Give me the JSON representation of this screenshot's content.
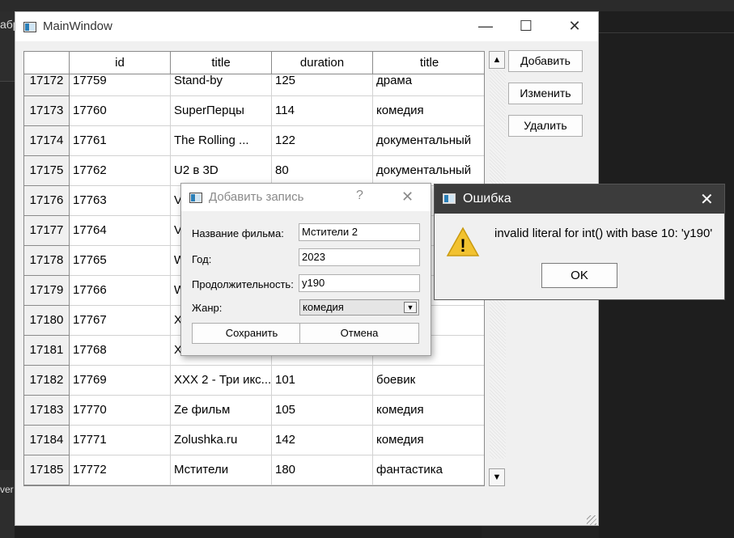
{
  "background": {
    "left_text_top": "абр",
    "left_text_bottom": "ver"
  },
  "main_window": {
    "title": "MainWindow",
    "controls": {
      "minimize": "—",
      "maximize": "☐",
      "close": "✕"
    },
    "table": {
      "headers": [
        "id",
        "title",
        "duration",
        "title"
      ],
      "rows": [
        {
          "row_header": "17172",
          "cells": [
            "17759",
            "Stand-by",
            "125",
            "драма"
          ]
        },
        {
          "row_header": "17173",
          "cells": [
            "17760",
            "SuperПерцы",
            "114",
            "комедия"
          ]
        },
        {
          "row_header": "17174",
          "cells": [
            "17761",
            "The Rolling ...",
            "122",
            "документальный"
          ]
        },
        {
          "row_header": "17175",
          "cells": [
            "17762",
            "U2 в 3D",
            "80",
            "документальный"
          ]
        },
        {
          "row_header": "17176",
          "cells": [
            "17763",
            "V",
            "",
            ""
          ]
        },
        {
          "row_header": "17177",
          "cells": [
            "17764",
            "V",
            "",
            ""
          ]
        },
        {
          "row_header": "17178",
          "cells": [
            "17765",
            "W",
            "",
            ""
          ]
        },
        {
          "row_header": "17179",
          "cells": [
            "17766",
            "W",
            "",
            ""
          ]
        },
        {
          "row_header": "17180",
          "cells": [
            "17767",
            "X",
            "",
            ""
          ]
        },
        {
          "row_header": "17181",
          "cells": [
            "17768",
            "X",
            "",
            ""
          ]
        },
        {
          "row_header": "17182",
          "cells": [
            "17769",
            "XXX 2 - Три икс...",
            "101",
            "боевик"
          ]
        },
        {
          "row_header": "17183",
          "cells": [
            "17770",
            "Ze фильм",
            "105",
            "комедия"
          ]
        },
        {
          "row_header": "17184",
          "cells": [
            "17771",
            "Zolushka.ru",
            "142",
            "комедия"
          ]
        },
        {
          "row_header": "17185",
          "cells": [
            "17772",
            "Мстители",
            "180",
            "фантастика"
          ]
        }
      ]
    },
    "buttons": {
      "add": "Добавить",
      "edit": "Изменить",
      "delete": "Удалить"
    }
  },
  "add_dialog": {
    "title": "Добавить запись",
    "help": "?",
    "close": "✕",
    "fields": {
      "name_label": "Название фильма:",
      "name_value": "Мстители 2",
      "year_label": "Год:",
      "year_value": "2023",
      "duration_label": "Продолжительность:",
      "duration_value": "y190",
      "genre_label": "Жанр:",
      "genre_value": "комедия"
    },
    "save": "Сохранить",
    "cancel": "Отмена"
  },
  "error_box": {
    "title": "Ошибка",
    "close": "✕",
    "message": "invalid literal for int() with base 10: 'y190'",
    "warning_symbol": "!",
    "ok": "OK"
  }
}
